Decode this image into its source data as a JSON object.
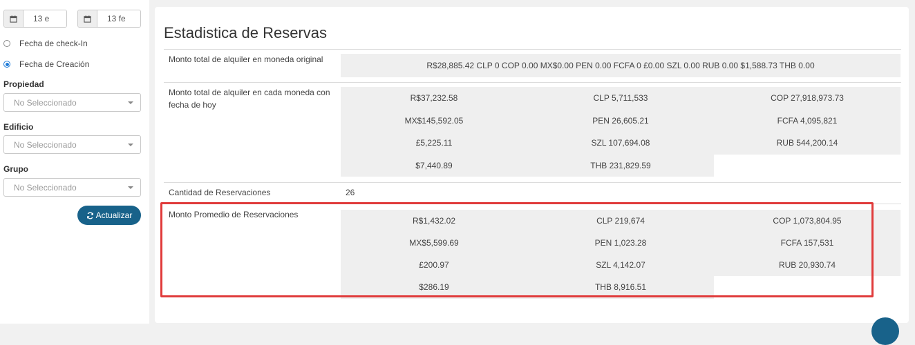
{
  "filters": {
    "start_date": "13 e",
    "end_date": "13 fe",
    "radio_checkin": "Fecha de check-In",
    "radio_creation": "Fecha de Creación",
    "property_label": "Propiedad",
    "property_value": "No Seleccionado",
    "building_label": "Edificio",
    "building_value": "No Seleccionado",
    "group_label": "Grupo",
    "group_value": "No Seleccionado",
    "update_button": "Actualizar"
  },
  "stats": {
    "title": "Estadistica de Reservas",
    "original_label": "Monto total de alquiler en moneda original",
    "original_value": "R$28,885.42 CLP 0 COP 0.00 MX$0.00 PEN 0.00 FCFA 0 £0.00 SZL 0.00 RUB 0.00 $1,588.73 THB 0.00",
    "today_label": "Monto total de alquiler en cada moneda con fecha de hoy",
    "today_values": [
      "R$37,232.58",
      "CLP 5,711,533",
      "COP 27,918,973.73",
      "MX$145,592.05",
      "PEN 26,605.21",
      "FCFA 4,095,821",
      "£5,225.11",
      "SZL 107,694.08",
      "RUB 544,200.14",
      "$7,440.89",
      "THB 231,829.59"
    ],
    "count_label": "Cantidad de Reservaciones",
    "count_value": "26",
    "avg_label": "Monto Promedio de Reservaciones",
    "avg_values": [
      "R$1,432.02",
      "CLP 219,674",
      "COP 1,073,804.95",
      "MX$5,599.69",
      "PEN 1,023.28",
      "FCFA 157,531",
      "£200.97",
      "SZL 4,142.07",
      "RUB 20,930.74",
      "$286.19",
      "THB 8,916.51"
    ]
  },
  "colors": {
    "accent": "#18628a",
    "highlight": "#e03b3b",
    "radio": "#1e7bd8"
  }
}
